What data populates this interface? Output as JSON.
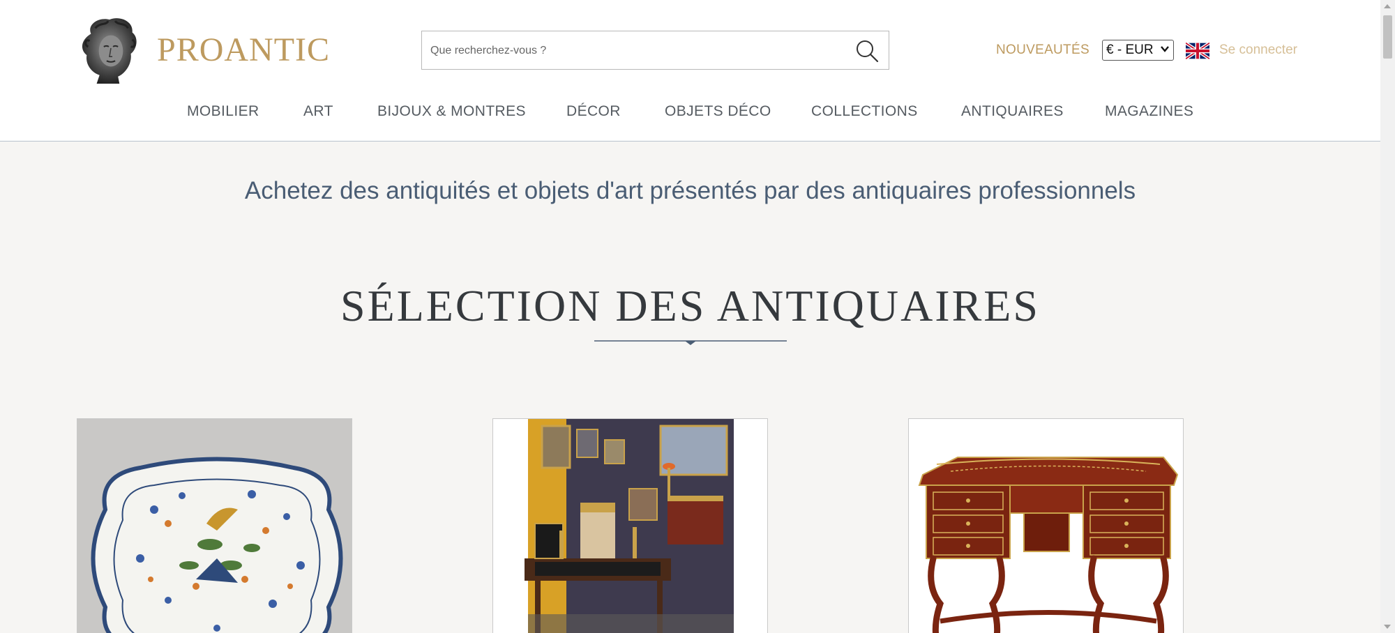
{
  "brand": {
    "name": "PROANTIC"
  },
  "search": {
    "placeholder": "Que recherchez-vous ?"
  },
  "topbar": {
    "news_label": "NOUVEAUTÉS",
    "currency_selected": "€ - EUR",
    "login_label": "Se connecter"
  },
  "nav": {
    "items": [
      {
        "label": "MOBILIER"
      },
      {
        "label": "ART"
      },
      {
        "label": "BIJOUX & MONTRES"
      },
      {
        "label": "DÉCOR"
      },
      {
        "label": "OBJETS DÉCO"
      },
      {
        "label": "COLLECTIONS"
      },
      {
        "label": "ANTIQUAIRES"
      },
      {
        "label": "MAGAZINES"
      }
    ]
  },
  "main": {
    "tagline": "Achetez des antiquités et objets d'art présentés par des antiquaires professionnels",
    "section_title": "SÉLECTION DES ANTIQUAIRES"
  },
  "colors": {
    "gold": "#bd9a5f",
    "gold_light": "#d6bf97",
    "slate_blue": "#4a5d74",
    "nav_text": "#555b61",
    "background": "#f6f5f3"
  },
  "icons": {
    "search": "search-icon",
    "flag": "uk-flag-icon",
    "dropdown": "chevron-down-icon"
  }
}
